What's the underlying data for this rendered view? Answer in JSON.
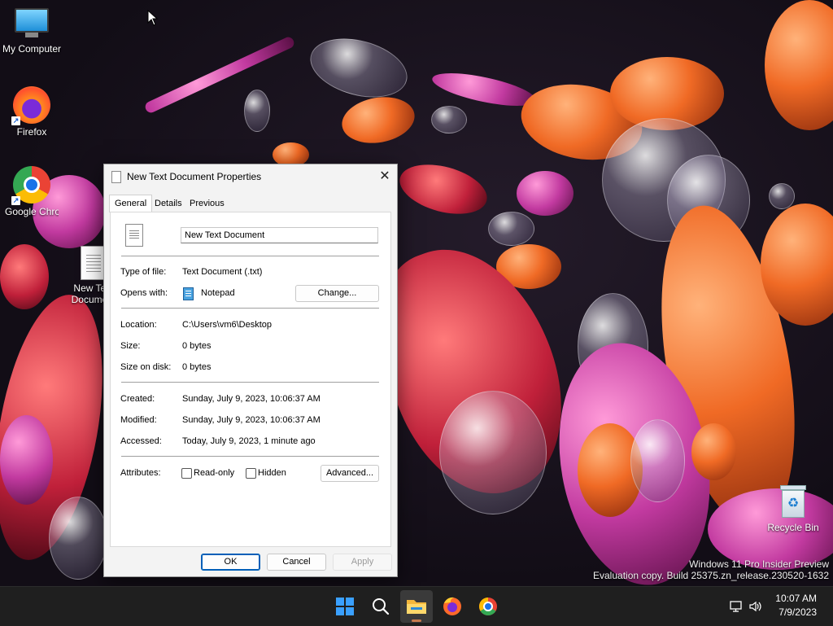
{
  "desktop": {
    "icons": [
      {
        "label": "My Computer"
      },
      {
        "label": "Firefox"
      },
      {
        "label": "Google Chrome"
      },
      {
        "label": "New Text Document"
      },
      {
        "label": "Recycle Bin"
      }
    ]
  },
  "dialog": {
    "title": "New Text Document Properties",
    "tabs": [
      "General",
      "Details",
      "Previous Versions"
    ],
    "active_tab": "General",
    "file_name": "New Text Document",
    "type_of_file_label": "Type of file:",
    "type_of_file_value": "Text Document (.txt)",
    "opens_with_label": "Opens with:",
    "opens_with_value": "Notepad",
    "change_button": "Change...",
    "location_label": "Location:",
    "location_value": "C:\\Users\\vm6\\Desktop",
    "size_label": "Size:",
    "size_value": "0 bytes",
    "size_on_disk_label": "Size on disk:",
    "size_on_disk_value": "0 bytes",
    "created_label": "Created:",
    "created_value": "Sunday, July 9, 2023, 10:06:37 AM",
    "modified_label": "Modified:",
    "modified_value": "Sunday, July 9, 2023, 10:06:37 AM",
    "accessed_label": "Accessed:",
    "accessed_value": "Today, July 9, 2023, 1 minute ago",
    "attributes_label": "Attributes:",
    "readonly_label": "Read-only",
    "readonly_checked": false,
    "hidden_label": "Hidden",
    "hidden_checked": false,
    "advanced_button": "Advanced...",
    "ok_button": "OK",
    "cancel_button": "Cancel",
    "apply_button": "Apply"
  },
  "watermark": {
    "line1": "Windows 11 Pro Insider Preview",
    "line2": "Evaluation copy. Build 25375.zn_release.230520-1632"
  },
  "taskbar": {
    "apps": [
      "start-icon",
      "search-icon",
      "file-explorer-icon",
      "firefox-icon",
      "chrome-icon"
    ],
    "active_app": "file-explorer-icon",
    "time": "10:07 AM",
    "date": "7/9/2023"
  },
  "colors": {
    "taskbar_bg": "#1f1f1f",
    "dialog_bg": "#f3f3f3",
    "primary_accent": "#005fb8",
    "start_blue": "#3aa0ff"
  }
}
